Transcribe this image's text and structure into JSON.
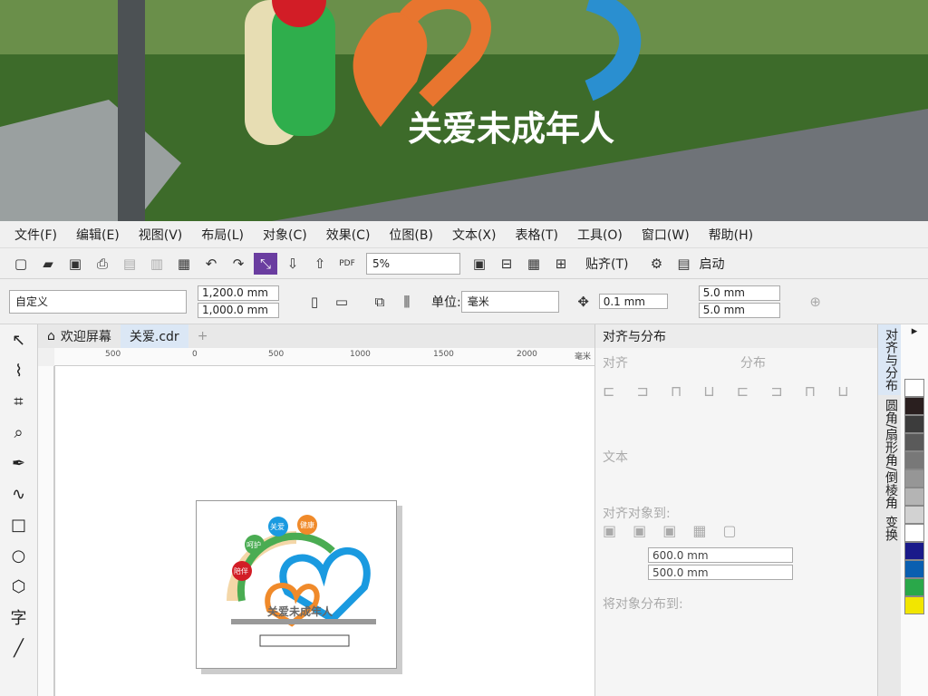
{
  "menu": [
    "文件(F)",
    "编辑(E)",
    "视图(V)",
    "布局(L)",
    "对象(C)",
    "效果(C)",
    "位图(B)",
    "文本(X)",
    "表格(T)",
    "工具(O)",
    "窗口(W)",
    "帮助(H)"
  ],
  "std": {
    "zoom": "5%",
    "snap": "贴齐(T)",
    "launch": "启动"
  },
  "prop": {
    "preset": "自定义",
    "width": "1,200.0 mm",
    "height": "1,000.0 mm",
    "unit_label": "单位:",
    "unit": "毫米",
    "nudge": "0.1 mm",
    "dup_x": "5.0 mm",
    "dup_y": "5.0 mm"
  },
  "tabs": {
    "welcome": "欢迎屏幕",
    "file": "关爱.cdr"
  },
  "ruler": [
    "500",
    "0",
    "500",
    "1000",
    "1500",
    "2000",
    "毫米"
  ],
  "art": {
    "slogan": "关爱未成年人",
    "b1": "关爱",
    "b2": "健康",
    "b3": "呵护",
    "b4": "陪伴"
  },
  "docker": {
    "title": "对齐与分布",
    "align": "对齐",
    "distribute": "分布",
    "text": "文本",
    "align_to": "对齐对象到:",
    "x": "600.0 mm",
    "y": "500.0 mm",
    "dist_to": "将对象分布到:"
  },
  "vtabs": [
    "对齐与分布",
    "圆角/扇形角/倒棱角",
    "变换"
  ],
  "palette": [
    "#ffffff",
    "#2a1f1f",
    "#3c3c3c",
    "#5a5a5a",
    "#787878",
    "#969696",
    "#b4b4b4",
    "#d2d2d2",
    "#ffffff",
    "#1a1a8a",
    "#0a5fb0",
    "#2aa84a",
    "#f2e600"
  ],
  "photo_text": "关爱未成年人"
}
